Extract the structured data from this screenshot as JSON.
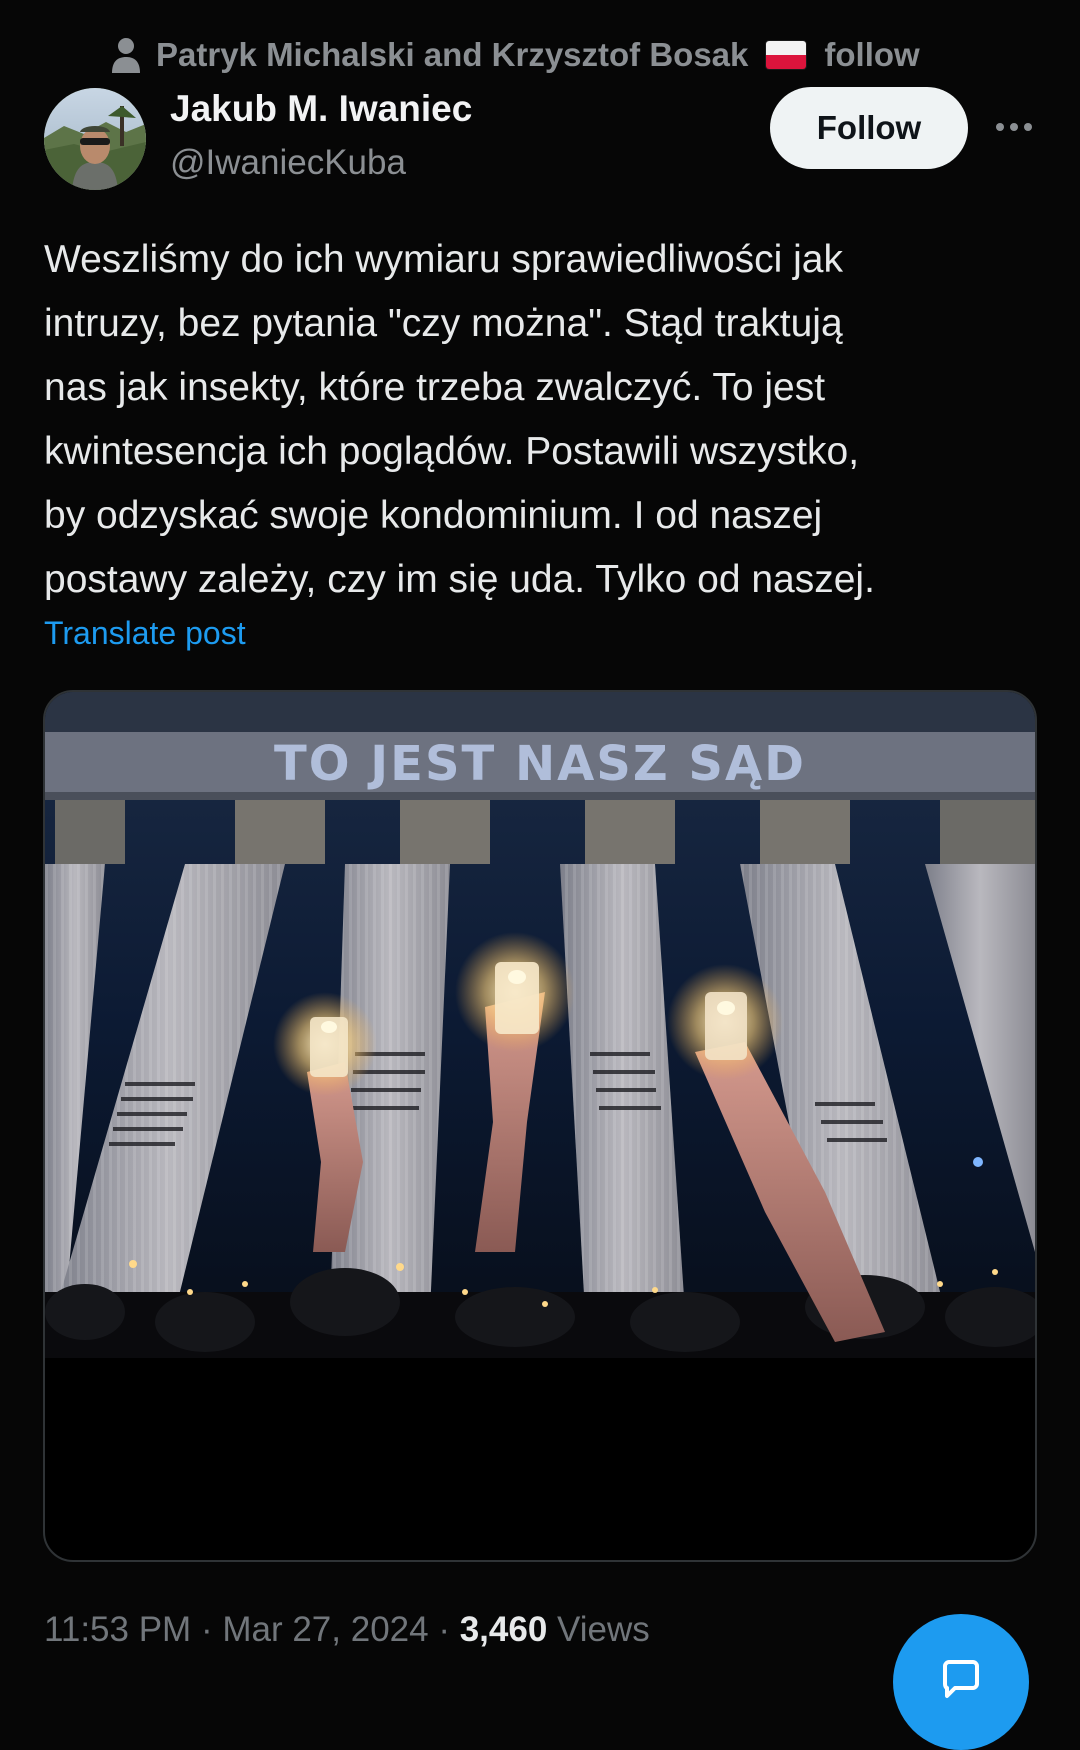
{
  "social_context": {
    "text": "Patryk Michalski and Krzysztof Bosak",
    "suffix": "follow",
    "icon": "person-icon",
    "flag": "poland-flag"
  },
  "author": {
    "display_name": "Jakub M. Iwaniec",
    "handle": "@IwaniecKuba"
  },
  "actions": {
    "follow_label": "Follow",
    "more_icon": "more-horizontal-icon"
  },
  "post": {
    "lines": [
      "Weszliśmy do ich wymiaru sprawiedliwości jak",
      "intruzy, bez pytania \"czy można\". Stąd traktują",
      "nas jak insekty, które trzeba zwalczyć. To jest",
      "kwintesencja ich poglądów. Postawili wszystko,",
      "by odzyskać swoje kondominium. I od naszej",
      "postawy zależy, czy im się uda. Tylko od naszej."
    ],
    "translate_label": "Translate post"
  },
  "media": {
    "banner_text": "TO JEST NASZ SĄD"
  },
  "meta": {
    "time": "11:53 PM",
    "separator": "·",
    "date": "Mar 27, 2024",
    "views_count": "3,460",
    "views_label": "Views"
  },
  "fab": {
    "icon": "compose-icon"
  },
  "colors": {
    "background": "#060606",
    "accent": "#1d9bf0",
    "muted_text": "#71767b"
  }
}
